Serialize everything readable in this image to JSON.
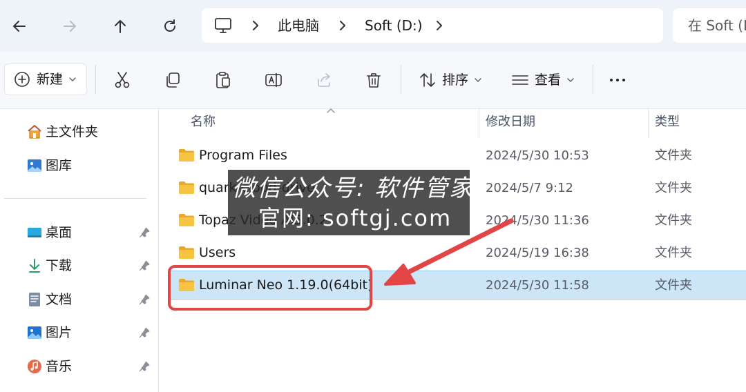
{
  "addressbar": {
    "breadcrumbs": [
      "此电脑",
      "Soft (D:)"
    ],
    "search_placeholder": "在 Soft (D:) 中搜索"
  },
  "toolbar": {
    "new_label": "新建",
    "sort_label": "排序",
    "view_label": "查看"
  },
  "nav": {
    "top_items": [
      {
        "label": "主文件夹",
        "icon": "home-icon"
      },
      {
        "label": "图库",
        "icon": "gallery-icon"
      }
    ],
    "pinned_items": [
      {
        "label": "桌面",
        "icon": "desktop-icon"
      },
      {
        "label": "下载",
        "icon": "download-icon"
      },
      {
        "label": "文档",
        "icon": "document-icon"
      },
      {
        "label": "图片",
        "icon": "pictures-icon"
      },
      {
        "label": "音乐",
        "icon": "music-icon"
      }
    ]
  },
  "filelist": {
    "columns": {
      "name": "名称",
      "modified": "修改日期",
      "type": "类型"
    },
    "rows": [
      {
        "name": "Program Files",
        "modified": "2024/5/30 10:53",
        "type": "文件夹"
      },
      {
        "name": "quark-cloud-drive",
        "modified": "2024/5/7 9:12",
        "type": "文件夹"
      },
      {
        "name": "Topaz Video AI5.0.2",
        "modified": "2024/5/30 11:36",
        "type": "文件夹"
      },
      {
        "name": "Users",
        "modified": "2024/5/19 16:38",
        "type": "文件夹"
      },
      {
        "name": "Luminar Neo 1.19.0(64bit)",
        "modified": "2024/5/30 11:58",
        "type": "文件夹",
        "selected": true
      }
    ]
  },
  "watermark": {
    "line1": "微信公众号: 软件管家",
    "line2": "官网: softgj.com"
  },
  "colors": {
    "selection_bg": "#cde6f7",
    "callout_red": "#e24545",
    "folder_yellow": "#f6c342"
  }
}
